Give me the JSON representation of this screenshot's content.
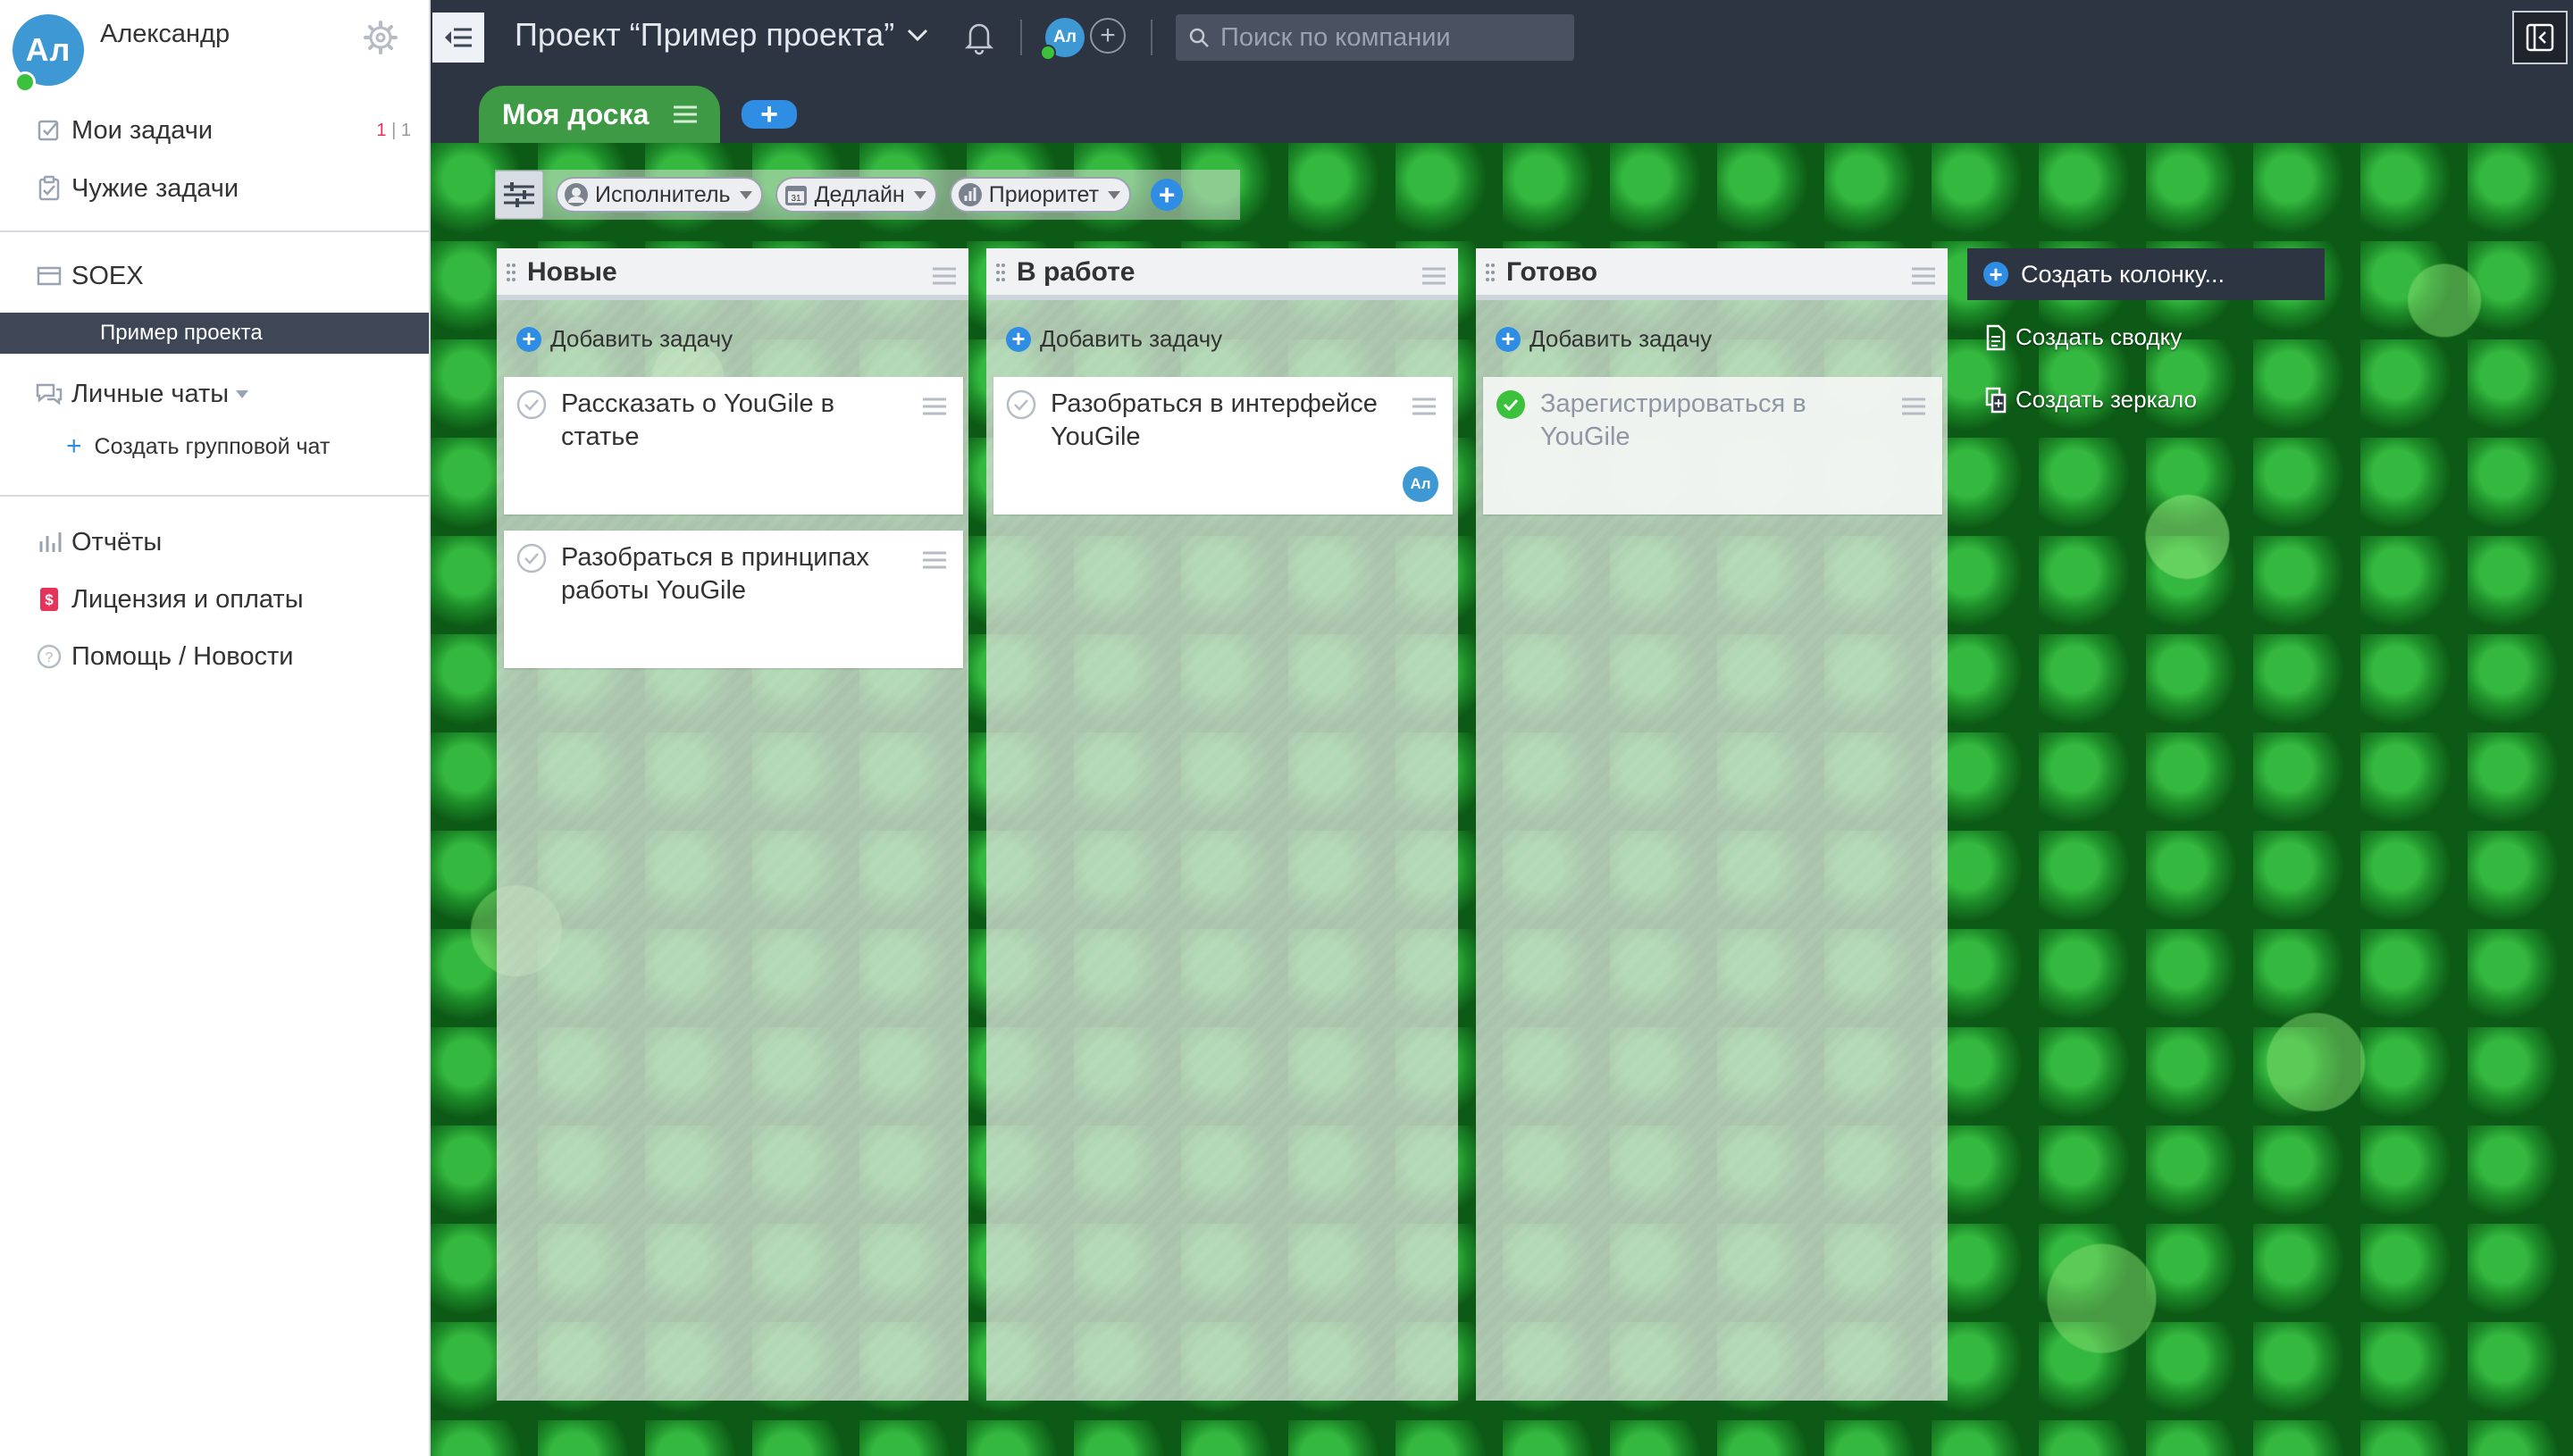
{
  "user": {
    "initials": "Ал",
    "name": "Александр"
  },
  "nav": {
    "my_tasks": {
      "label": "Мои задачи",
      "count_new": "1",
      "count_sep": "|",
      "count_total": "1"
    },
    "others_tasks": "Чужие задачи",
    "company": "SOEX",
    "project": "Пример проекта",
    "personal_chats": "Личные чаты",
    "create_group_chat": "Создать групповой чат",
    "reports": "Отчёты",
    "license": "Лицензия и оплаты",
    "help": "Помощь / Новости"
  },
  "topbar": {
    "project_title": "Проект “Пример проекта”",
    "member_initials": "Ал",
    "search_placeholder": "Поиск по компании"
  },
  "board": {
    "tab_name": "Моя доска",
    "add_board": "+",
    "filters": [
      "Исполнитель",
      "Дедлайн",
      "Приоритет"
    ],
    "filter_add": "+",
    "add_task_label": "Добавить задачу",
    "columns": [
      {
        "title": "Новые",
        "cards": [
          {
            "text": "Рассказать о YouGile в статье",
            "done": false
          },
          {
            "text": "Разобраться в принципах работы YouGile",
            "done": false
          }
        ]
      },
      {
        "title": "В работе",
        "cards": [
          {
            "text": "Разобраться в интерфейсе YouGile",
            "done": false,
            "assignee": "Ал"
          }
        ]
      },
      {
        "title": "Готово",
        "cards": [
          {
            "text": "Зарегистрироваться в YouGile",
            "done": true
          }
        ]
      }
    ],
    "create_column": "Создать колонку...",
    "create_summary": "Создать сводку",
    "create_mirror": "Создать зеркало"
  },
  "colors": {
    "accent": "#2f8de4",
    "dark": "#2e3542",
    "active_project": "#3f4756",
    "done_check": "#3cc13c",
    "counter_red": "#e6335a"
  }
}
